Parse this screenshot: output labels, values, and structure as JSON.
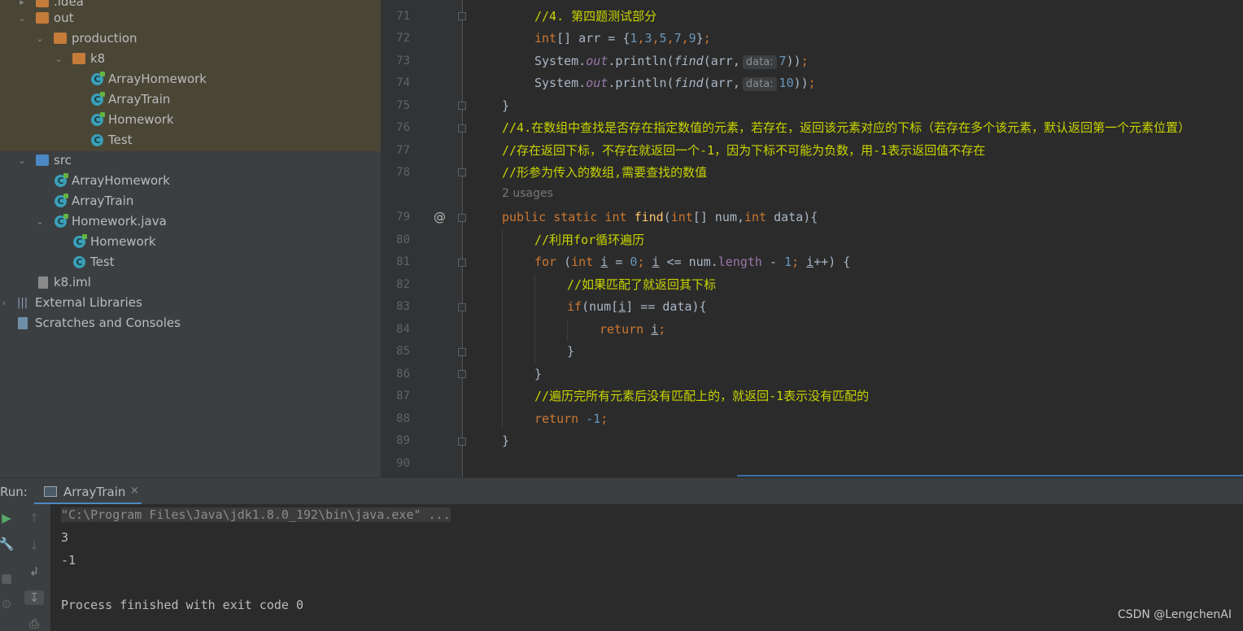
{
  "tree": {
    "items": [
      {
        "label": ".idea",
        "indent": 0,
        "kind": "folder"
      },
      {
        "label": "out",
        "indent": 0,
        "kind": "folder"
      },
      {
        "label": "production",
        "indent": 1,
        "kind": "folder"
      },
      {
        "label": "k8",
        "indent": 2,
        "kind": "folder"
      },
      {
        "label": "ArrayHomework",
        "indent": 3,
        "kind": "class"
      },
      {
        "label": "ArrayTrain",
        "indent": 3,
        "kind": "class"
      },
      {
        "label": "Homework",
        "indent": 3,
        "kind": "class"
      },
      {
        "label": "Test",
        "indent": 3,
        "kind": "class"
      },
      {
        "label": "src",
        "indent": 0,
        "kind": "folder"
      },
      {
        "label": "ArrayHomework",
        "indent": 1,
        "kind": "class"
      },
      {
        "label": "ArrayTrain",
        "indent": 1,
        "kind": "class"
      },
      {
        "label": "Homework.java",
        "indent": 1,
        "kind": "class"
      },
      {
        "label": "Homework",
        "indent": 2,
        "kind": "class"
      },
      {
        "label": "Test",
        "indent": 2,
        "kind": "class"
      },
      {
        "label": "k8.iml",
        "indent": 0,
        "kind": "file"
      },
      {
        "label": "External Libraries",
        "indent": -1,
        "kind": "lib"
      },
      {
        "label": "Scratches and Consoles",
        "indent": -1,
        "kind": "scratch"
      }
    ]
  },
  "editor": {
    "line_numbers": [
      "71",
      "72",
      "73",
      "74",
      "75",
      "76",
      "77",
      "78",
      "79",
      "80",
      "81",
      "82",
      "83",
      "84",
      "85",
      "86",
      "87",
      "88",
      "89",
      "90"
    ],
    "usages": "2 usages",
    "override_marker": "@",
    "hint_label": "data:",
    "code": {
      "l71": "//4. 第四题测试部分",
      "l72a": "int",
      "l72b": "[] arr = {",
      "l72c": "1",
      "l72d": ",",
      "l72e": "3",
      "l72f": ",",
      "l72g": "5",
      "l72h": ",",
      "l72i": "7",
      "l72j": ",",
      "l72k": "9",
      "l72l": "}",
      "l72m": ";",
      "l73a": "System.",
      "l73b": "out",
      "l73c": ".println(",
      "l73d": "find",
      "l73e": "(arr,",
      "l73f": "7",
      "l73g": "))",
      "l73h": ";",
      "l74a": "System.",
      "l74b": "out",
      "l74c": ".println(",
      "l74d": "find",
      "l74e": "(arr,",
      "l74f": "10",
      "l74g": "))",
      "l74h": ";",
      "l75": "}",
      "l76": "//4.在数组中查找是否存在指定数值的元素，若存在，返回该元素对应的下标（若存在多个该元素，默认返回第一个元素位置）",
      "l77": "//存在返回下标，不存在就返回一个-1，因为下标不可能为负数，用-1表示返回值不存在",
      "l78": "//形参为传入的数组,需要查找的数值",
      "l79a": "public static int ",
      "l79b": "find",
      "l79c": "(",
      "l79d": "int",
      "l79e": "[] num,",
      "l79f": "int",
      "l79g": " data){",
      "l80": "//利用for循环遍历",
      "l81a": "for ",
      "l81b": "(",
      "l81c": "int ",
      "l81d": "i",
      "l81e": " = ",
      "l81f": "0",
      "l81g": "; ",
      "l81h": "i",
      "l81i": " <= num.",
      "l81j": "length",
      "l81k": " - ",
      "l81l": "1",
      "l81m": "; ",
      "l81n": "i",
      "l81o": "++) {",
      "l82": "//如果匹配了就返回其下标",
      "l83a": "if",
      "l83b": "(num[",
      "l83c": "i",
      "l83d": "] == data){",
      "l84a": "return ",
      "l84b": "i",
      "l84c": ";",
      "l85": "}",
      "l86": "}",
      "l87": "//遍历完所有元素后没有匹配上的，就返回-1表示没有匹配的",
      "l88a": "return ",
      "l88b": "-1",
      "l88c": ";",
      "l89": "}"
    }
  },
  "run": {
    "label": "Run:",
    "tab": "ArrayTrain",
    "tab_close": "×",
    "console_lines": [
      "\"C:\\Program Files\\Java\\jdk1.8.0_192\\bin\\java.exe\" ...",
      "3",
      "-1",
      "",
      "Process finished with exit code 0"
    ]
  },
  "watermark": "CSDN @LengchenAI",
  "colors": {
    "comment": "#c8d400",
    "keyword": "#cc7832",
    "number": "#6897bb",
    "function": "#ffc66d",
    "field": "#9876aa",
    "accent": "#4a88c7"
  }
}
